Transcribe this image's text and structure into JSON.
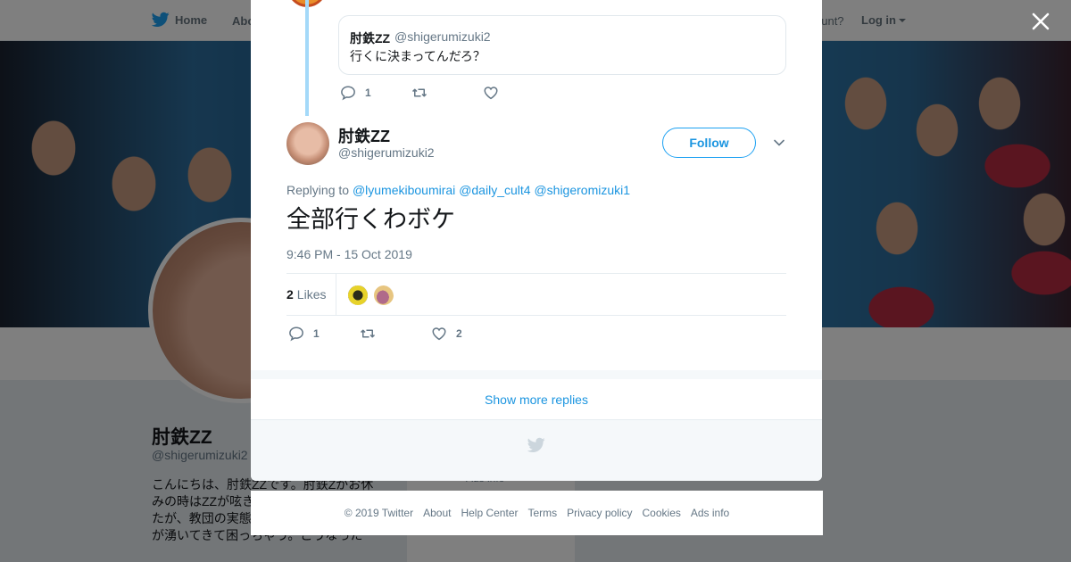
{
  "nav": {
    "home_label": "Home",
    "about_label": "Abo",
    "have_account": "ccount?",
    "login_label": "Log in"
  },
  "profile": {
    "name": "肘鉄ZZ",
    "handle": "@shigerumizuki2",
    "bio": "こんにちは、肘鉄ZZです。肘鉄Zがお休みの時はZZが呟き。高じて幸福の科学したが、教団の実態を知れば知るほど怒りが湧いてきて困っちゃう。こうなった",
    "side_text": "Ads info"
  },
  "quote": {
    "name": "肘鉄ZZ",
    "handle": "@shigerumizuki2",
    "text": "行くに決まってんだろ？"
  },
  "parent_actions": {
    "reply_count": "1",
    "retweet_count": "",
    "like_count": ""
  },
  "tweet": {
    "name": "肘鉄ZZ",
    "handle": "@shigerumizuki2",
    "follow_label": "Follow",
    "replying_prefix": "Replying to",
    "mentions": [
      "@lyumekiboumirai",
      "@daily_cult4",
      "@shigeromizuki1"
    ],
    "text": "全部行くわボケ",
    "timestamp": "9:46 PM - 15 Oct 2019",
    "likes_count": "2",
    "likes_label": "Likes",
    "reply_count": "1",
    "retweet_count": "",
    "like_count": "2"
  },
  "modal": {
    "show_more": "Show more replies"
  },
  "footer": {
    "copyright": "© 2019 Twitter",
    "links": [
      "About",
      "Help Center",
      "Terms",
      "Privacy policy",
      "Cookies",
      "Ads info"
    ]
  },
  "colors": {
    "accent": "#1da1f2",
    "link": "#1b95e0",
    "secondary_text": "#657786",
    "thread_line": "#a4d9f9"
  },
  "icons": [
    "twitter-bird-icon",
    "close-icon",
    "reply-icon",
    "retweet-icon",
    "heart-icon",
    "chevron-down-icon",
    "caret-down-icon"
  ]
}
